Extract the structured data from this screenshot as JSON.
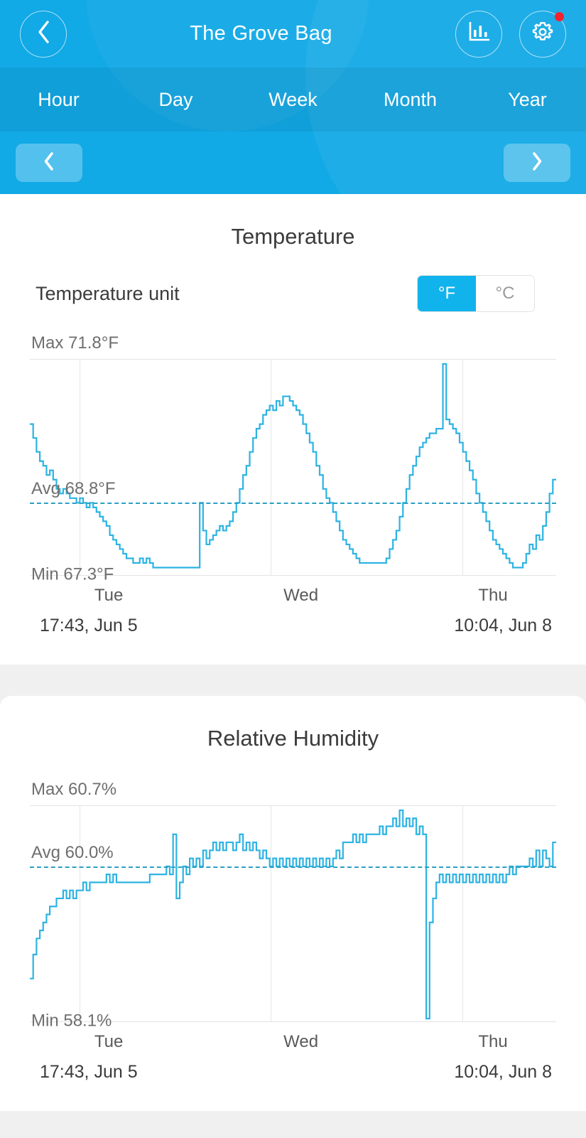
{
  "header": {
    "title": "The Grove Bag",
    "back_icon": "chevron-left-icon",
    "stats_icon": "bar-chart-icon",
    "settings_icon": "gear-icon",
    "settings_badge": true,
    "accent": "#11a9e6",
    "badge_color": "#f5222d"
  },
  "tabs": [
    {
      "label": "Hour"
    },
    {
      "label": "Day"
    },
    {
      "label": "Week"
    },
    {
      "label": "Month"
    },
    {
      "label": "Year"
    }
  ],
  "pager": {
    "prev_icon": "chevron-left-icon",
    "next_icon": "chevron-right-icon"
  },
  "temperature": {
    "title": "Temperature",
    "unit_label": "Temperature unit",
    "unit_options": [
      {
        "label": "°F",
        "selected": true
      },
      {
        "label": "°C",
        "selected": false
      }
    ],
    "max_label": "Max 71.8°F",
    "avg_label": "Avg 68.8°F",
    "min_label": "Min 67.3°F",
    "x_ticks": [
      "Tue",
      "Wed",
      "Thu"
    ],
    "range_start": "17:43,  Jun 5",
    "range_end": "10:04,  Jun 8"
  },
  "humidity": {
    "title": "Relative Humidity",
    "max_label": "Max 60.7%",
    "avg_label": "Avg 60.0%",
    "min_label": "Min 58.1%",
    "x_ticks": [
      "Tue",
      "Wed",
      "Thu"
    ],
    "range_start": "17:43,  Jun 5",
    "range_end": "10:04,  Jun 8"
  },
  "chart_data": [
    {
      "type": "line",
      "title": "Temperature",
      "xlabel": "",
      "ylabel": "°F",
      "ylim": [
        67.3,
        71.8
      ],
      "grid": true,
      "legend": "none",
      "stats": {
        "max": 71.8,
        "avg": 68.8,
        "min": 67.3,
        "unit": "°F"
      },
      "x_tick_labels": [
        "Tue",
        "Wed",
        "Thu"
      ],
      "x_tick_positions": [
        0.095,
        0.457,
        0.82
      ],
      "x_start": "17:43, Jun 5",
      "x_end": "10:04, Jun 8",
      "avg_reference_line": 68.8,
      "line_color": "#2cb3e3",
      "values": [
        70.5,
        70.2,
        69.9,
        69.7,
        69.6,
        69.4,
        69.5,
        69.3,
        69.1,
        69.0,
        69.1,
        69.0,
        68.9,
        68.9,
        68.8,
        68.9,
        68.8,
        68.7,
        68.8,
        68.7,
        68.6,
        68.5,
        68.4,
        68.3,
        68.1,
        68.0,
        67.9,
        67.8,
        67.7,
        67.6,
        67.6,
        67.5,
        67.5,
        67.6,
        67.5,
        67.6,
        67.5,
        67.4,
        67.4,
        67.4,
        67.4,
        67.4,
        67.4,
        67.4,
        67.4,
        67.4,
        67.4,
        67.4,
        67.4,
        67.4,
        67.4,
        68.8,
        68.2,
        67.9,
        68.0,
        68.1,
        68.2,
        68.3,
        68.2,
        68.3,
        68.4,
        68.6,
        68.8,
        69.1,
        69.4,
        69.6,
        69.9,
        70.2,
        70.4,
        70.5,
        70.7,
        70.8,
        70.9,
        70.8,
        71.0,
        70.9,
        71.1,
        71.1,
        71.0,
        70.9,
        70.8,
        70.7,
        70.5,
        70.3,
        70.1,
        69.9,
        69.6,
        69.4,
        69.1,
        68.9,
        68.8,
        68.6,
        68.4,
        68.2,
        68.0,
        67.9,
        67.8,
        67.7,
        67.6,
        67.5,
        67.5,
        67.5,
        67.5,
        67.5,
        67.5,
        67.5,
        67.5,
        67.6,
        67.8,
        68.0,
        68.2,
        68.5,
        68.8,
        69.1,
        69.4,
        69.6,
        69.8,
        70.0,
        70.1,
        70.2,
        70.3,
        70.3,
        70.4,
        70.4,
        71.8,
        70.6,
        70.5,
        70.4,
        70.3,
        70.1,
        69.9,
        69.7,
        69.5,
        69.3,
        69.0,
        68.8,
        68.6,
        68.4,
        68.2,
        68.0,
        67.9,
        67.8,
        67.7,
        67.6,
        67.5,
        67.4,
        67.4,
        67.4,
        67.5,
        67.7,
        67.9,
        67.8,
        68.1,
        68.0,
        68.3,
        68.6,
        69.0,
        69.3
      ]
    },
    {
      "type": "line",
      "title": "Relative Humidity",
      "xlabel": "",
      "ylabel": "%",
      "ylim": [
        58.1,
        60.7
      ],
      "grid": true,
      "legend": "none",
      "stats": {
        "max": 60.7,
        "avg": 60.0,
        "min": 58.1,
        "unit": "%"
      },
      "x_tick_labels": [
        "Tue",
        "Wed",
        "Thu"
      ],
      "x_tick_positions": [
        0.095,
        0.457,
        0.82
      ],
      "x_start": "17:43, Jun 5",
      "x_end": "10:04, Jun 8",
      "avg_reference_line": 60.0,
      "line_color": "#2cb3e3",
      "values": [
        58.6,
        58.9,
        59.1,
        59.2,
        59.3,
        59.4,
        59.5,
        59.5,
        59.6,
        59.6,
        59.7,
        59.6,
        59.7,
        59.6,
        59.7,
        59.7,
        59.8,
        59.7,
        59.8,
        59.8,
        59.8,
        59.8,
        59.8,
        59.9,
        59.8,
        59.9,
        59.8,
        59.8,
        59.8,
        59.8,
        59.8,
        59.8,
        59.8,
        59.8,
        59.8,
        59.8,
        59.9,
        59.9,
        59.9,
        59.9,
        59.9,
        60.0,
        59.9,
        60.4,
        59.6,
        59.8,
        60.0,
        59.9,
        60.1,
        60.0,
        60.1,
        60.0,
        60.2,
        60.1,
        60.2,
        60.3,
        60.2,
        60.3,
        60.2,
        60.3,
        60.3,
        60.2,
        60.3,
        60.4,
        60.2,
        60.3,
        60.2,
        60.3,
        60.2,
        60.1,
        60.2,
        60.1,
        60.0,
        60.1,
        60.0,
        60.1,
        60.0,
        60.1,
        60.0,
        60.1,
        60.0,
        60.1,
        60.0,
        60.1,
        60.0,
        60.1,
        60.0,
        60.1,
        60.0,
        60.1,
        60.0,
        60.1,
        60.2,
        60.1,
        60.3,
        60.3,
        60.3,
        60.4,
        60.3,
        60.4,
        60.3,
        60.4,
        60.4,
        60.4,
        60.4,
        60.5,
        60.4,
        60.5,
        60.5,
        60.6,
        60.5,
        60.7,
        60.5,
        60.6,
        60.5,
        60.6,
        60.4,
        60.5,
        60.4,
        58.1,
        59.3,
        59.6,
        59.8,
        59.9,
        59.8,
        59.9,
        59.8,
        59.9,
        59.8,
        59.9,
        59.8,
        59.9,
        59.8,
        59.9,
        59.8,
        59.9,
        59.8,
        59.9,
        59.8,
        59.9,
        59.8,
        59.9,
        59.8,
        59.9,
        60.0,
        59.9,
        60.0,
        60.0,
        60.0,
        60.0,
        60.1,
        60.0,
        60.2,
        60.0,
        60.2,
        60.1,
        60.0,
        60.3
      ]
    }
  ]
}
